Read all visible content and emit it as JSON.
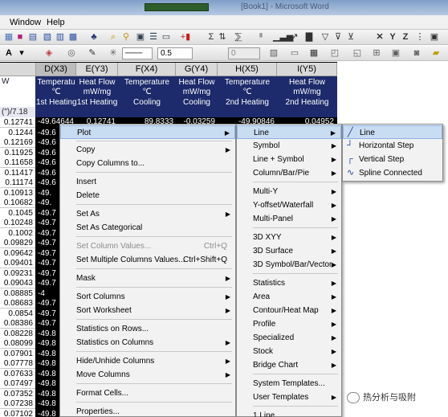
{
  "window": {
    "title": "[Book1] - Microsoft Word",
    "menus": [
      "Window",
      "Help"
    ]
  },
  "toolbar": {
    "line_width_value": "0.5",
    "font_size_value": "0",
    "dropdown_value": "0",
    "icons": [
      "font-color-icon",
      "fill-color-icon",
      "line-color-icon",
      "line-style-icon",
      "sum-icon",
      "sort-icon",
      "bar-chart-icon",
      "filter-icon",
      "close-icon",
      "x-axis-icon",
      "y-axis-icon",
      "z-axis-icon"
    ]
  },
  "grid": {
    "columns": [
      {
        "header": "D(X3)",
        "long_name": "Temperatu",
        "units": "℃",
        "comment": "1st Heating",
        "selected": true
      },
      {
        "header": "E(Y3)",
        "long_name": "Heat Flow",
        "units": "mW/mg",
        "comment": "1st Heating",
        "selected": false
      },
      {
        "header": "F(X4)",
        "long_name": "Temperature",
        "units": "℃",
        "comment": "Cooling",
        "selected": false
      },
      {
        "header": "G(Y4)",
        "long_name": "Heat Flow",
        "units": "mW/mg",
        "comment": "Cooling",
        "selected": false
      },
      {
        "header": "H(X5)",
        "long_name": "Temperature",
        "units": "℃",
        "comment": "2nd Heating",
        "selected": false
      },
      {
        "header": "I(Y5)",
        "long_name": "Heat Flow",
        "units": "mW/mg",
        "comment": "2nd Heating",
        "selected": false
      }
    ],
    "row_header_label": "W",
    "row_header_formula": "(\")/7.18",
    "first_row": [
      "-49.64644",
      "0.12741",
      "89.8333",
      "-0.03259",
      "-49.90846",
      "0.04952"
    ],
    "row_values": [
      "0.12741",
      "0.1244",
      "0.12169",
      "0.11925",
      "0.11658",
      "0.11417",
      "0.11174",
      "0.10913",
      "0.10682",
      "0.1045",
      "0.10248",
      "0.1002",
      "0.09829",
      "0.09642",
      "0.09401",
      "0.09231",
      "0.09043",
      "0.08885",
      "0.08683",
      "0.0854",
      "0.08386",
      "0.08228",
      "0.08099",
      "0.07901",
      "0.07778",
      "0.07633",
      "0.07497",
      "0.07352",
      "0.07238",
      "0.07102"
    ],
    "d_values": [
      "-49.64644",
      "-49.6",
      "-49.6",
      "-49.6",
      "-49.6",
      "-49.6",
      "-49.6",
      "-49.",
      "-49.",
      "-49.7",
      "-49.7",
      "-49.7",
      "-49.7",
      "-49.7",
      "-49.7",
      "-49.7",
      "-49.7",
      "-4",
      "-49.7",
      "-49.7",
      "-49.7",
      "-49.8",
      "-49.8",
      "-49.8",
      "-49.8",
      "-49.8",
      "-49.8",
      "-49.8",
      "-49.8",
      "-49.8"
    ]
  },
  "context_menu": {
    "items": [
      {
        "label": "Plot",
        "has_sub": true,
        "highlighted": true
      },
      {
        "label": "Copy",
        "has_sub": true
      },
      {
        "label": "Copy Columns to...",
        "has_sub": false
      },
      {
        "label": "Insert",
        "has_sub": false
      },
      {
        "label": "Delete",
        "has_sub": false
      },
      {
        "label": "Set As",
        "has_sub": true
      },
      {
        "label": "Set As Categorical",
        "has_sub": false
      },
      {
        "label": "Set Column Values...",
        "shortcut": "Ctrl+Q",
        "disabled": true
      },
      {
        "label": "Set Multiple Columns Values...",
        "shortcut": "Ctrl+Shift+Q"
      },
      {
        "label": "Mask",
        "has_sub": true
      },
      {
        "label": "Sort Columns",
        "has_sub": true
      },
      {
        "label": "Sort Worksheet",
        "has_sub": true
      },
      {
        "label": "Statistics on Rows...",
        "has_sub": false
      },
      {
        "label": "Statistics on Columns",
        "has_sub": true
      },
      {
        "label": "Hide/Unhide Columns",
        "has_sub": true
      },
      {
        "label": "Move Columns",
        "has_sub": true
      },
      {
        "label": "Format Cells...",
        "has_sub": false
      },
      {
        "label": "Properties...",
        "has_sub": false
      }
    ]
  },
  "plot_submenu": {
    "items": [
      {
        "label": "Line",
        "highlighted": true
      },
      {
        "label": "Symbol"
      },
      {
        "label": "Line + Symbol"
      },
      {
        "label": "Column/Bar/Pie"
      },
      {
        "label": "Multi-Y"
      },
      {
        "label": "Y-offset/Waterfall"
      },
      {
        "label": "Multi-Panel"
      },
      {
        "label": "3D XYY"
      },
      {
        "label": "3D Surface"
      },
      {
        "label": "3D Symbol/Bar/Vector"
      },
      {
        "label": "Statistics"
      },
      {
        "label": "Area"
      },
      {
        "label": "Contour/Heat Map"
      },
      {
        "label": "Profile"
      },
      {
        "label": "Specialized"
      },
      {
        "label": "Stock"
      },
      {
        "label": "Bridge Chart"
      },
      {
        "label": "System Templates..."
      },
      {
        "label": "User Templates"
      },
      {
        "label": "1 Line"
      }
    ]
  },
  "line_submenu": {
    "items": [
      {
        "label": "Line",
        "icon": "line-icon",
        "highlighted": true
      },
      {
        "label": "Horizontal Step",
        "icon": "horizontal-step-icon"
      },
      {
        "label": "Vertical Step",
        "icon": "vertical-step-icon"
      },
      {
        "label": "Spline Connected",
        "icon": "spline-icon"
      }
    ]
  },
  "watermark": {
    "text": "热分析与吸附"
  }
}
